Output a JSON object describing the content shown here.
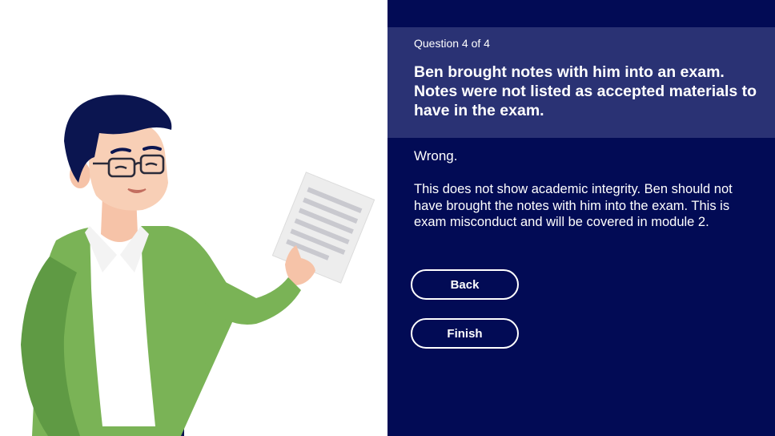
{
  "quiz": {
    "counter": "Question 4 of 4",
    "question": "Ben brought notes with him into an exam. Notes were not listed as accepted materials to have in the exam.",
    "feedback_title": "Wrong.",
    "feedback_text": "This does not show academic integrity. Ben should not have brought the notes with him into the exam. This is exam misconduct and will be covered in module 2.",
    "back_label": "Back",
    "finish_label": "Finish"
  },
  "colors": {
    "panel_bg": "#020b55",
    "question_bg": "#2a3274",
    "sweater": "#7ab356",
    "hair": "#0b1550"
  }
}
